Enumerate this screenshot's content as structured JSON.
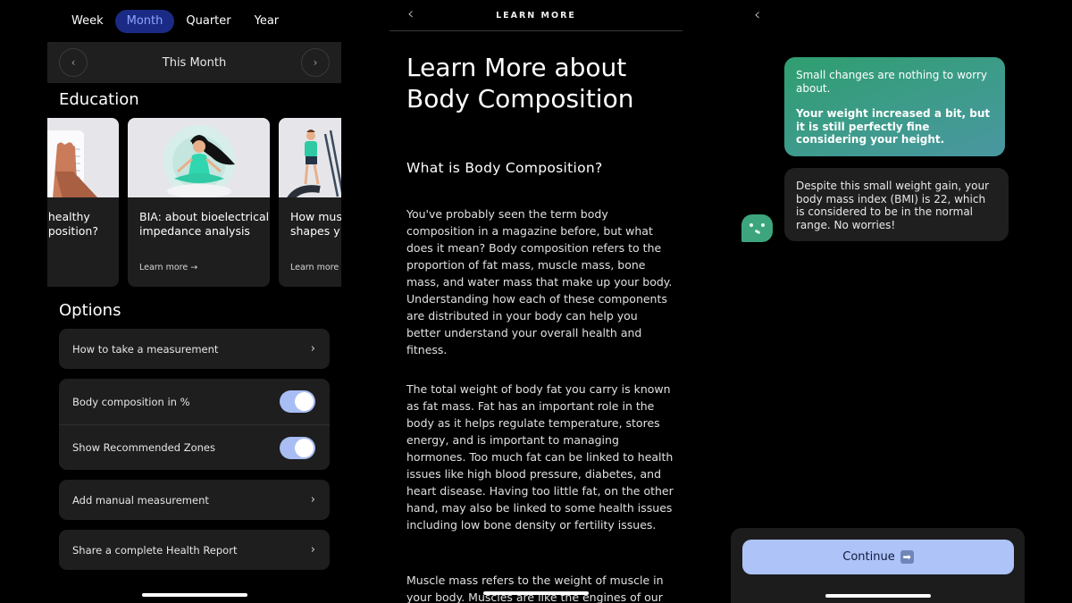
{
  "screen1": {
    "period_tabs": [
      {
        "label": "Week",
        "active": false
      },
      {
        "label": "Month",
        "active": true
      },
      {
        "label": "Quarter",
        "active": false
      },
      {
        "label": "Year",
        "active": false
      }
    ],
    "month_nav": {
      "label": "This Month",
      "prev_icon": "‹",
      "next_icon": "›"
    },
    "education": {
      "title": "Education",
      "cards": [
        {
          "title_line1": "healthy",
          "title_line2": "position?",
          "learn_more": "→",
          "illustration": "foot-on-scale"
        },
        {
          "title": "BIA: about bioelectrical impedance analysis",
          "learn_more": "Learn more →",
          "illustration": "meditating-woman"
        },
        {
          "title": "How mus shapes y",
          "learn_more": "Learn more",
          "illustration": "man-on-elliptical"
        }
      ]
    },
    "options": {
      "title": "Options",
      "items": [
        {
          "label": "How to take a measurement",
          "type": "link",
          "icon": "›"
        },
        {
          "label": "Body composition in %",
          "type": "toggle",
          "on": true
        },
        {
          "label": "Show Recommended Zones",
          "type": "toggle",
          "on": true
        },
        {
          "label": "Add manual measurement",
          "type": "link",
          "icon": "›"
        },
        {
          "label": "Share a complete Health Report",
          "type": "link",
          "icon": "›"
        }
      ]
    }
  },
  "screen2": {
    "header_title": "LEARN MORE",
    "back_icon": "‹",
    "title": "Learn More about Body Composition",
    "subtitle": "What is Body Composition?",
    "paragraphs": [
      "You've probably seen the term body composition in a magazine before, but what does it mean? Body composition refers to the proportion of fat mass, muscle mass, bone mass, and water mass that make up your body. Understanding how each of these components are distributed in your body can help you better understand your overall health and fitness.",
      "The total weight of body fat you carry is known as fat mass. Fat has an important role in the body as it helps regulate temperature, stores energy, and is important to managing hormones. Too much fat can be linked to health issues like high blood pressure, diabetes, and heart disease. Having too little fat, on the other hand, may also be linked to some health issues including low bone density or fertility issues.",
      "Muscle mass refers to the weight of muscle in your body. Muscles are like the engines of our"
    ]
  },
  "screen3": {
    "back_icon": "‹",
    "bubble_green": {
      "line1": "Small changes are nothing to worry about.",
      "line2": "Your weight increased a bit, but it is still perfectly fine considering your height."
    },
    "bubble_dark": "Despite this small weight gain, your body mass index (BMI) is 22, which is considered to be in the normal range. No worries!",
    "continue_label": "Continue",
    "continue_icon": "➡"
  },
  "colors": {
    "active_tab_bg": "#1b2b85",
    "active_tab_text": "#8fa3ff",
    "toggle_on": "#a9bdf5",
    "continue_button": "#aec3f8",
    "bot_green": "#3da57d"
  }
}
